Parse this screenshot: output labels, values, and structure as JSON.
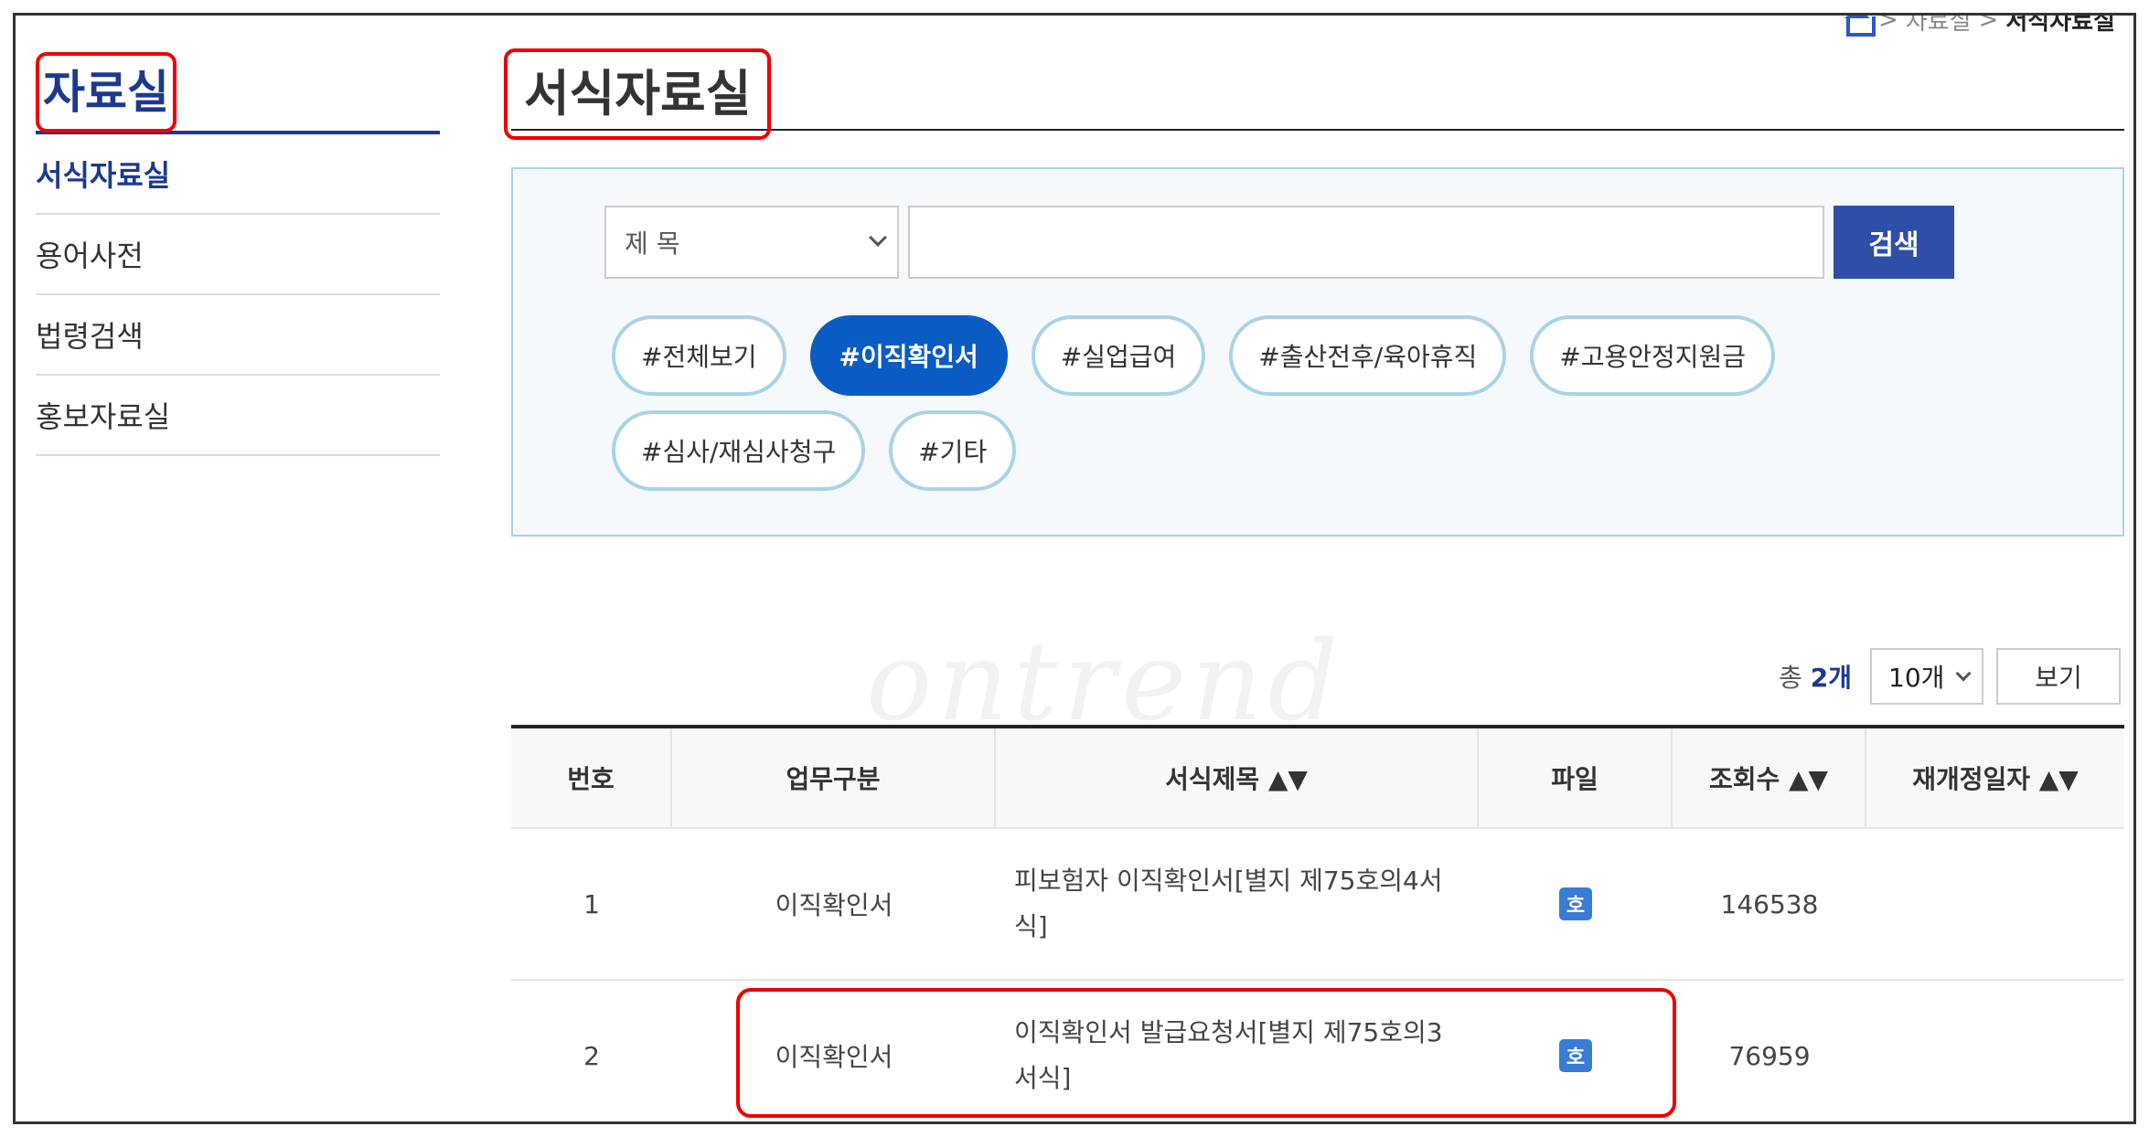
{
  "breadcrumb": {
    "level1": "자료실",
    "current": "서식자료실"
  },
  "sidebar": {
    "title": "자료실",
    "items": [
      {
        "label": "서식자료실"
      },
      {
        "label": "용어사전"
      },
      {
        "label": "법령검색"
      },
      {
        "label": "홍보자료실"
      }
    ]
  },
  "page": {
    "title": "서식자료실"
  },
  "search": {
    "select_value": "제 목",
    "input_value": "",
    "button_label": "검색"
  },
  "tags": [
    "#전체보기",
    "#이직확인서",
    "#실업급여",
    "#출산전후/육아휴직",
    "#고용안정지원금",
    "#심사/재심사청구",
    "#기타"
  ],
  "list": {
    "total_prefix": "총",
    "total_count": "2개",
    "per_page": "10개",
    "view_label": "보기"
  },
  "watermark": "ontrend",
  "table": {
    "headers": [
      "번호",
      "업무구분",
      "서식제목 ▲▼",
      "파일",
      "조회수 ▲▼",
      "재개정일자 ▲▼"
    ],
    "rows": [
      {
        "no": "1",
        "category": "이직확인서",
        "title": "피보험자 이직확인서[별지 제75호의4서식]",
        "file_icon": "호",
        "views": "146538",
        "date": ""
      },
      {
        "no": "2",
        "category": "이직확인서",
        "title": "이직확인서 발급요청서[별지 제75호의3서식]",
        "file_icon": "호",
        "views": "76959",
        "date": ""
      }
    ]
  },
  "colors": {
    "accent": "#1b3a8f",
    "active_tag": "#0b5bc4",
    "tag_border": "#a9d3e6",
    "highlight": "#e00000"
  }
}
